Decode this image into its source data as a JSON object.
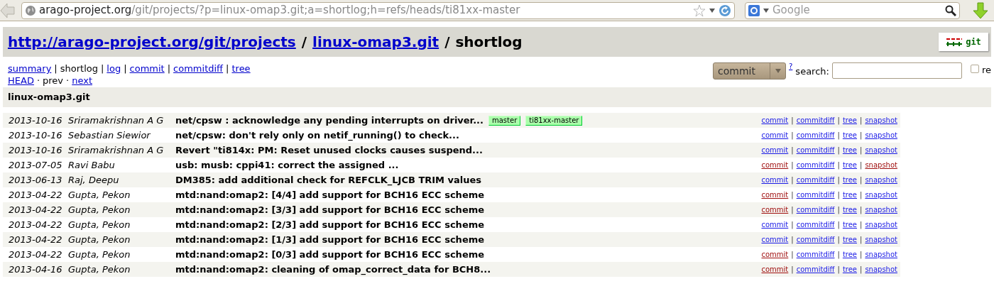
{
  "browser": {
    "url_host": "arago-project.org",
    "url_path": "/git/projects/?p=linux-omap3.git;a=shortlog;h=refs/heads/ti81xx-master",
    "search_placeholder": "Google"
  },
  "header": {
    "title": [
      {
        "text": "http://arago-project.org/git/projects",
        "kind": "link"
      },
      {
        "text": "/",
        "kind": "sep"
      },
      {
        "text": "linux-omap3.git",
        "kind": "link"
      },
      {
        "text": "/",
        "kind": "sep"
      },
      {
        "text": "shortlog",
        "kind": "text"
      }
    ],
    "logo": "git"
  },
  "nav": [
    [
      {
        "text": "summary",
        "kind": "link"
      },
      {
        "text": "|",
        "kind": "sep"
      },
      {
        "text": "shortlog",
        "kind": "text"
      },
      {
        "text": "|",
        "kind": "sep"
      },
      {
        "text": "log",
        "kind": "link"
      },
      {
        "text": "|",
        "kind": "sep"
      },
      {
        "text": "commit",
        "kind": "link"
      },
      {
        "text": "|",
        "kind": "sep"
      },
      {
        "text": "commitdiff",
        "kind": "link"
      },
      {
        "text": "|",
        "kind": "sep"
      },
      {
        "text": "tree",
        "kind": "link"
      }
    ],
    [
      {
        "text": "HEAD",
        "kind": "link"
      },
      {
        "text": "·",
        "kind": "sep"
      },
      {
        "text": "prev",
        "kind": "text"
      },
      {
        "text": "·",
        "kind": "sep"
      },
      {
        "text": "next",
        "kind": "link"
      }
    ]
  ],
  "search": {
    "type": "commit",
    "help": "?",
    "label": "search:",
    "regex_checked": false,
    "regex_label": "re"
  },
  "project": "linux-omap3.git",
  "rows": [
    {
      "date": "2013-10-16",
      "author": "Sriramakrishnan A G",
      "title": "net/cpsw : acknowledge any pending interrupts on driver...",
      "refs": [
        "master",
        "ti81xx-master"
      ],
      "links": [
        {
          "kind": "link",
          "text": "commit",
          "visited": false
        },
        {
          "kind": "sep",
          "text": "|"
        },
        {
          "kind": "link",
          "text": "commitdiff",
          "visited": false
        },
        {
          "kind": "sep",
          "text": "|"
        },
        {
          "kind": "link",
          "text": "tree",
          "visited": false
        },
        {
          "kind": "sep",
          "text": "|"
        },
        {
          "kind": "link",
          "text": "snapshot",
          "visited": false
        }
      ]
    },
    {
      "date": "2013-10-16",
      "author": "Sebastian Siewior",
      "title": "net/cpsw: don't rely only on netif_running() to check...",
      "links": [
        {
          "kind": "link",
          "text": "commit",
          "visited": false
        },
        {
          "kind": "sep",
          "text": "|"
        },
        {
          "kind": "link",
          "text": "commitdiff",
          "visited": false
        },
        {
          "kind": "sep",
          "text": "|"
        },
        {
          "kind": "link",
          "text": "tree",
          "visited": false
        },
        {
          "kind": "sep",
          "text": "|"
        },
        {
          "kind": "link",
          "text": "snapshot",
          "visited": false
        }
      ]
    },
    {
      "date": "2013-10-16",
      "author": "Sriramakrishnan A G",
      "title": "Revert \"ti814x: PM: Reset unused clocks causes suspend...",
      "links": [
        {
          "kind": "link",
          "text": "commit",
          "visited": false
        },
        {
          "kind": "sep",
          "text": "|"
        },
        {
          "kind": "link",
          "text": "commitdiff",
          "visited": false
        },
        {
          "kind": "sep",
          "text": "|"
        },
        {
          "kind": "link",
          "text": "tree",
          "visited": false
        },
        {
          "kind": "sep",
          "text": "|"
        },
        {
          "kind": "link",
          "text": "snapshot",
          "visited": false
        }
      ]
    },
    {
      "date": "2013-07-05",
      "author": "Ravi Babu",
      "title": "usb: musb: cppi41: correct the assigned ...",
      "links": [
        {
          "kind": "link",
          "text": "commit",
          "visited": true
        },
        {
          "kind": "sep",
          "text": "|"
        },
        {
          "kind": "link",
          "text": "commitdiff",
          "visited": false
        },
        {
          "kind": "sep",
          "text": "|"
        },
        {
          "kind": "link",
          "text": "tree",
          "visited": false
        },
        {
          "kind": "sep",
          "text": "|"
        },
        {
          "kind": "link",
          "text": "snapshot",
          "visited": true
        }
      ]
    },
    {
      "date": "2013-06-13",
      "author": "Raj, Deepu",
      "title": "DM385: add additional check for REFCLK_LJCB TRIM values",
      "links": [
        {
          "kind": "link",
          "text": "commit",
          "visited": false
        },
        {
          "kind": "sep",
          "text": "|"
        },
        {
          "kind": "link",
          "text": "commitdiff",
          "visited": false
        },
        {
          "kind": "sep",
          "text": "|"
        },
        {
          "kind": "link",
          "text": "tree",
          "visited": false
        },
        {
          "kind": "sep",
          "text": "|"
        },
        {
          "kind": "link",
          "text": "snapshot",
          "visited": false
        }
      ]
    },
    {
      "date": "2013-04-22",
      "author": "Gupta, Pekon",
      "title": "mtd:nand:omap2: [4/4] add support for BCH16 ECC scheme",
      "links": [
        {
          "kind": "link",
          "text": "commit",
          "visited": true
        },
        {
          "kind": "sep",
          "text": "|"
        },
        {
          "kind": "link",
          "text": "commitdiff",
          "visited": false
        },
        {
          "kind": "sep",
          "text": "|"
        },
        {
          "kind": "link",
          "text": "tree",
          "visited": false
        },
        {
          "kind": "sep",
          "text": "|"
        },
        {
          "kind": "link",
          "text": "snapshot",
          "visited": false
        }
      ]
    },
    {
      "date": "2013-04-22",
      "author": "Gupta, Pekon",
      "title": "mtd:nand:omap2: [3/3] add support for BCH16 ECC scheme",
      "links": [
        {
          "kind": "link",
          "text": "commit",
          "visited": true
        },
        {
          "kind": "sep",
          "text": "|"
        },
        {
          "kind": "link",
          "text": "commitdiff",
          "visited": false
        },
        {
          "kind": "sep",
          "text": "|"
        },
        {
          "kind": "link",
          "text": "tree",
          "visited": false
        },
        {
          "kind": "sep",
          "text": "|"
        },
        {
          "kind": "link",
          "text": "snapshot",
          "visited": false
        }
      ]
    },
    {
      "date": "2013-04-22",
      "author": "Gupta, Pekon",
      "title": "mtd:nand:omap2: [2/3] add support for BCH16 ECC scheme",
      "links": [
        {
          "kind": "link",
          "text": "commit",
          "visited": false
        },
        {
          "kind": "sep",
          "text": "|"
        },
        {
          "kind": "link",
          "text": "commitdiff",
          "visited": false
        },
        {
          "kind": "sep",
          "text": "|"
        },
        {
          "kind": "link",
          "text": "tree",
          "visited": false
        },
        {
          "kind": "sep",
          "text": "|"
        },
        {
          "kind": "link",
          "text": "snapshot",
          "visited": false
        }
      ]
    },
    {
      "date": "2013-04-22",
      "author": "Gupta, Pekon",
      "title": "mtd:nand:omap2: [1/3] add support for BCH16 ECC scheme",
      "links": [
        {
          "kind": "link",
          "text": "commit",
          "visited": false
        },
        {
          "kind": "sep",
          "text": "|"
        },
        {
          "kind": "link",
          "text": "commitdiff",
          "visited": false
        },
        {
          "kind": "sep",
          "text": "|"
        },
        {
          "kind": "link",
          "text": "tree",
          "visited": false
        },
        {
          "kind": "sep",
          "text": "|"
        },
        {
          "kind": "link",
          "text": "snapshot",
          "visited": false
        }
      ]
    },
    {
      "date": "2013-04-22",
      "author": "Gupta, Pekon",
      "title": "mtd:nand:omap2: [0/3] add support for BCH16 ECC scheme",
      "links": [
        {
          "kind": "link",
          "text": "commit",
          "visited": true
        },
        {
          "kind": "sep",
          "text": "|"
        },
        {
          "kind": "link",
          "text": "commitdiff",
          "visited": false
        },
        {
          "kind": "sep",
          "text": "|"
        },
        {
          "kind": "link",
          "text": "tree",
          "visited": false
        },
        {
          "kind": "sep",
          "text": "|"
        },
        {
          "kind": "link",
          "text": "snapshot",
          "visited": false
        }
      ]
    },
    {
      "date": "2013-04-16",
      "author": "Gupta, Pekon",
      "title": "mtd:nand:omap2: cleaning of omap_correct_data for BCH8...",
      "links": [
        {
          "kind": "link",
          "text": "commit",
          "visited": true
        },
        {
          "kind": "sep",
          "text": "|"
        },
        {
          "kind": "link",
          "text": "commitdiff",
          "visited": false
        },
        {
          "kind": "sep",
          "text": "|"
        },
        {
          "kind": "link",
          "text": "tree",
          "visited": false
        },
        {
          "kind": "sep",
          "text": "|"
        },
        {
          "kind": "link",
          "text": "snapshot",
          "visited": false
        }
      ]
    }
  ]
}
